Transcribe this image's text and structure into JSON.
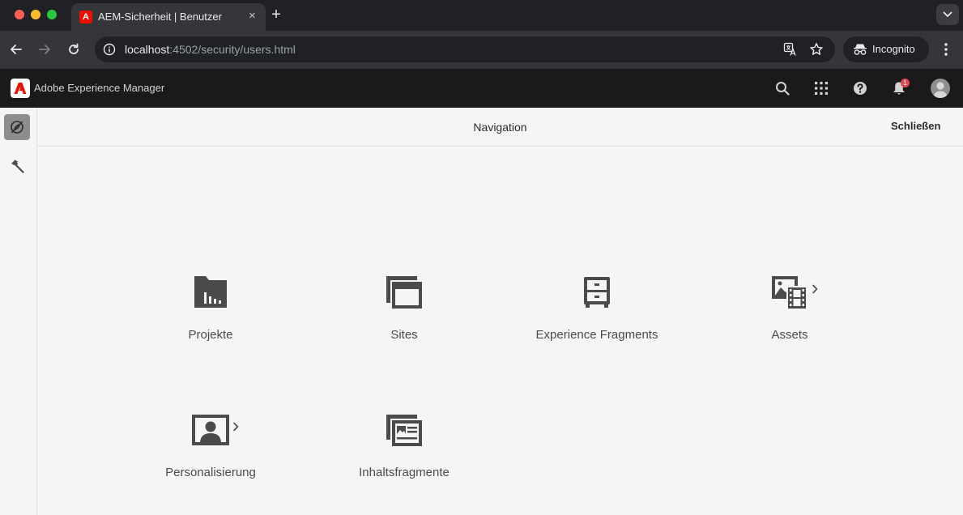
{
  "browser": {
    "tab": {
      "title": "AEM-Sicherheit | Benutzer",
      "favicon": "adobe-icon"
    },
    "url": {
      "host": "localhost",
      "path": ":4502/security/users.html"
    },
    "incognito_label": "Incognito"
  },
  "shell": {
    "title": "Adobe Experience Manager",
    "notification_count": "1"
  },
  "panel": {
    "title": "Navigation",
    "close_label": "Schließen"
  },
  "tiles": [
    {
      "label": "Projekte",
      "icon": "projects-icon",
      "has_children": false
    },
    {
      "label": "Sites",
      "icon": "sites-icon",
      "has_children": false
    },
    {
      "label": "Experience Fragments",
      "icon": "experience-fragments-icon",
      "has_children": false
    },
    {
      "label": "Assets",
      "icon": "assets-icon",
      "has_children": true
    },
    {
      "label": "Personalisierung",
      "icon": "personalization-icon",
      "has_children": true
    },
    {
      "label": "Inhaltsfragmente",
      "icon": "content-fragments-icon",
      "has_children": false
    }
  ],
  "colors": {
    "icon": "#4b4b4b",
    "shell_bg": "#1a1a1a",
    "adobe_red": "#eb1000",
    "badge": "#e34850"
  }
}
